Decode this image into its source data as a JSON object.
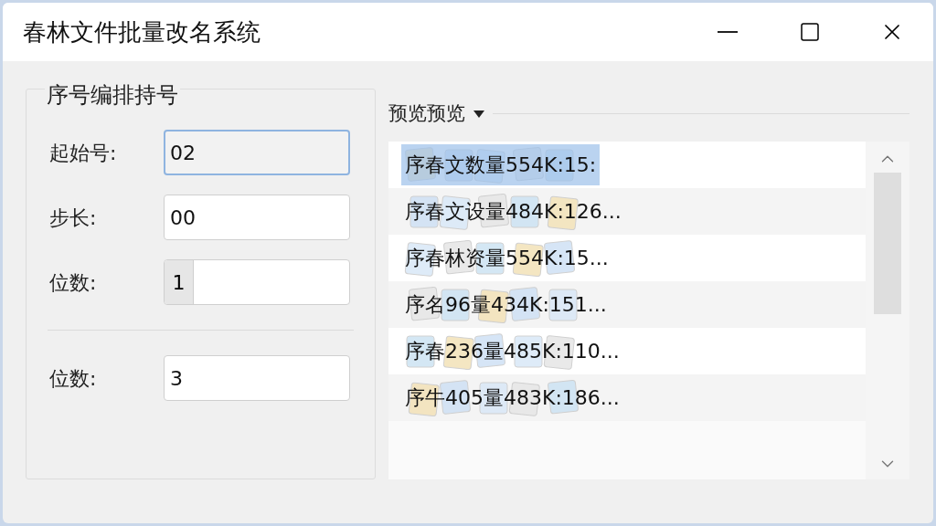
{
  "window": {
    "title": "春林文件批量改名系统"
  },
  "numbering_group": {
    "title": "序号编排持号",
    "fields": [
      {
        "label": "起始号:",
        "value": "02",
        "kind": "text",
        "focused": true
      },
      {
        "label": "步长:",
        "value": "00",
        "kind": "text",
        "focused": false
      },
      {
        "label": "位数:",
        "value": "1",
        "kind": "spinner"
      },
      {
        "kind": "divider"
      },
      {
        "label": "位数:",
        "value": "3",
        "kind": "text",
        "focused": false
      }
    ]
  },
  "preview": {
    "title": "预览预览",
    "rows": [
      {
        "text": "序春文数量554K:15:",
        "selected": true
      },
      {
        "text": "序春文设量484K:126...",
        "selected": false
      },
      {
        "text": "序春林资量554K:15...",
        "selected": false
      },
      {
        "text": "序名96量434K:151...",
        "selected": false
      },
      {
        "text": "序春236量485K:110...",
        "selected": false
      },
      {
        "text": "序牛405量483K:186...",
        "selected": false
      }
    ]
  }
}
